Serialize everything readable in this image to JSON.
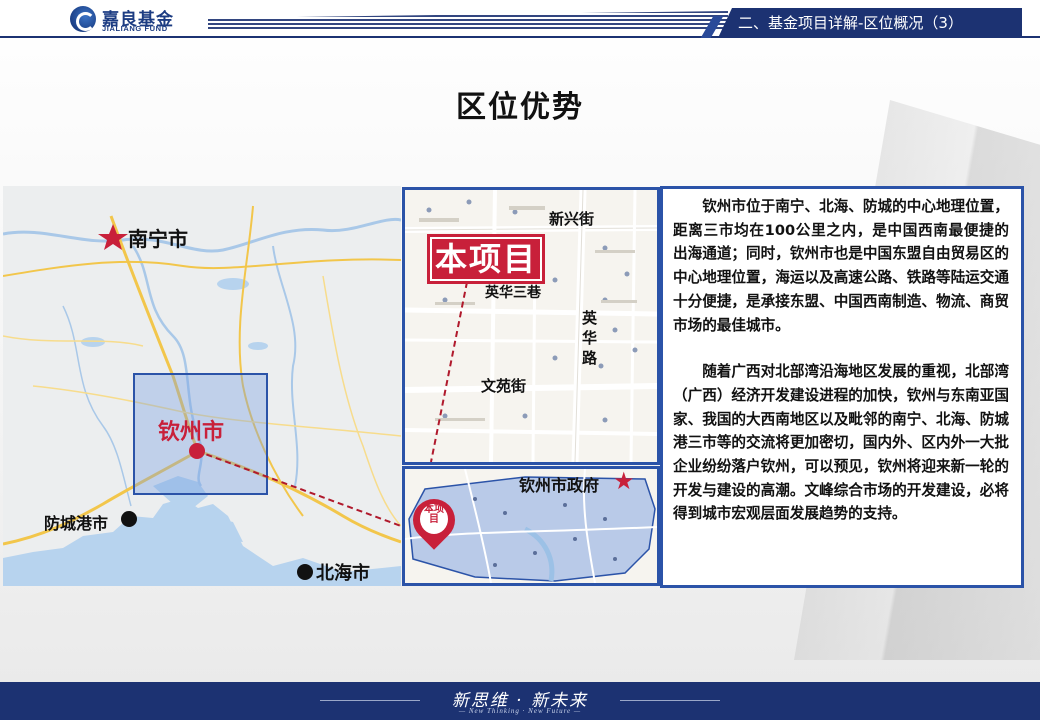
{
  "header": {
    "logo_cn": "嘉良基金",
    "logo_en": "JIALIANG FUND",
    "section": "二、基金项目详解-区位概况（3）"
  },
  "page_title": "区位优势",
  "map_left": {
    "cities": {
      "nanning": "南宁市",
      "qinzhou": "钦州市",
      "fangchenggang": "防城港市",
      "beihai": "北海市"
    },
    "colors": {
      "star": "#c8203a",
      "highlight_box": "#2b53a8"
    }
  },
  "map_right": {
    "project_label": "本项目",
    "streets": {
      "xinxing": "新兴街",
      "yinghua_lane": "英华三巷",
      "yinghua_road": "英华路",
      "wenyuan": "文苑街"
    },
    "government": "钦州市政府",
    "pin_label": "本项目"
  },
  "description": {
    "para1": "钦州市位于南宁、北海、防城的中心地理位置，距离三市均在100公里之内，是中国西南最便捷的出海通道；同时，钦州市也是中国东盟自由贸易区的中心地理位置，海运以及高速公路、铁路等陆运交通十分便捷，是承接东盟、中国西南制造、物流、商贸市场的最佳城市。",
    "para2": "随着广西对北部湾沿海地区发展的重视，北部湾（广西）经济开发建设进程的加快，钦州与东南亚国家、我国的大西南地区以及毗邻的南宁、北海、防城港三市等的交流将更加密切，国内外、区内外一大批企业纷纷落户钦州，可以预见，钦州将迎来新一轮的开发与建设的高潮。文峰综合市场的开发建设，必将得到城市宏观层面发展趋势的支持。"
  },
  "footer": {
    "slogan": "新思维 · 新未来",
    "slogan_en": "— New Thinking · New Future —"
  }
}
